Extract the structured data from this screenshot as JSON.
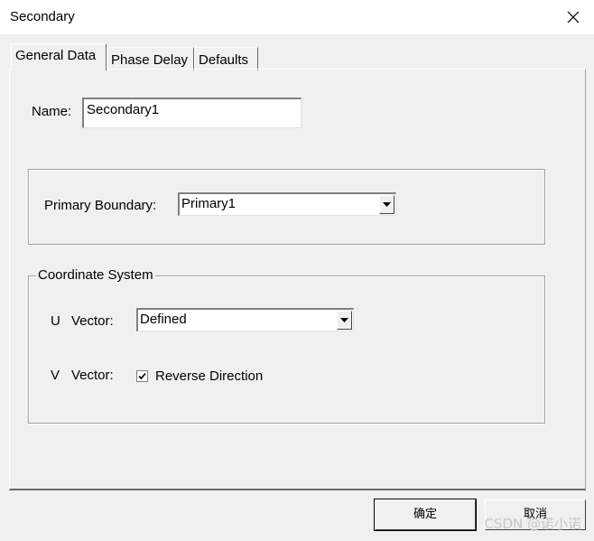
{
  "window": {
    "title": "Secondary"
  },
  "tabs": [
    {
      "label": "General Data",
      "selected": true
    },
    {
      "label": "Phase Delay",
      "selected": false
    },
    {
      "label": "Defaults",
      "selected": false
    }
  ],
  "general": {
    "name_label": "Name:",
    "name_value": "Secondary1",
    "primary_boundary_label": "Primary Boundary:",
    "primary_boundary_value": "Primary1"
  },
  "coordinate_system": {
    "title": "Coordinate System",
    "u_label": "U",
    "u_vector_label": "Vector:",
    "u_vector_value": "Defined",
    "v_label": "V",
    "v_vector_label": "Vector:",
    "reverse_direction_label": "Reverse Direction",
    "reverse_direction_checked": true
  },
  "buttons": {
    "ok_label": "确定",
    "cancel_label": "取消"
  },
  "watermark": "CSDN @诺小诺",
  "icons": {
    "close": "close-icon",
    "dropdown": "chevron-down-icon",
    "check": "check-icon"
  }
}
